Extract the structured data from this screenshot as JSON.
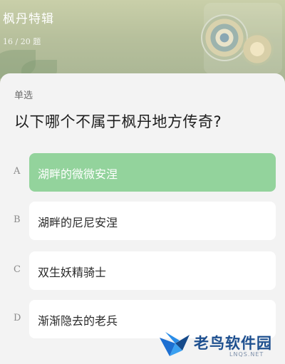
{
  "header": {
    "title": "枫丹特辑",
    "progress": "16 / 20 题"
  },
  "question": {
    "type_label": "单选",
    "text": "以下哪个不属于枫丹地方传奇?"
  },
  "options": [
    {
      "letter": "A",
      "label": "湖畔的微微安涅",
      "selected": true
    },
    {
      "letter": "B",
      "label": "湖畔的尼尼安涅",
      "selected": false
    },
    {
      "letter": "C",
      "label": "双生妖精骑士",
      "selected": false
    },
    {
      "letter": "D",
      "label": "渐渐隐去的老兵",
      "selected": false
    }
  ],
  "watermark": {
    "text": "老鸟软件园",
    "sub": "LNQS.NET"
  },
  "colors": {
    "selected_option": "#93d39c",
    "watermark_blue": "#1d4f8f"
  }
}
